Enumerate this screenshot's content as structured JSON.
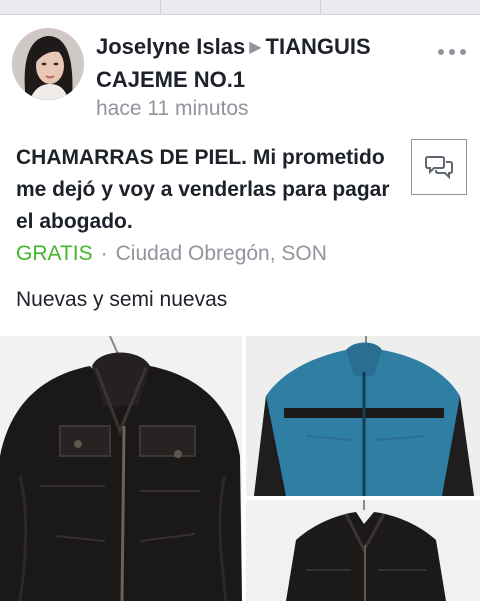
{
  "post": {
    "author": "Joselyne Islas",
    "group": "TIANGUIS CAJEME NO.1",
    "timestamp": "hace 11 minutos",
    "title": "CHAMARRAS DE PIEL. Mi prometido me dejó y voy a venderlas para pagar el abogado.",
    "price": "GRATIS",
    "separator": "·",
    "location": "Ciudad Obregón, SON",
    "description": "Nuevas y semi nuevas"
  },
  "icons": {
    "arrow": "▶",
    "more": "more-options-icon",
    "message": "message-icon"
  },
  "colors": {
    "price_green": "#42b72a",
    "secondary_text": "#90949c",
    "primary_text": "#1d2129"
  }
}
